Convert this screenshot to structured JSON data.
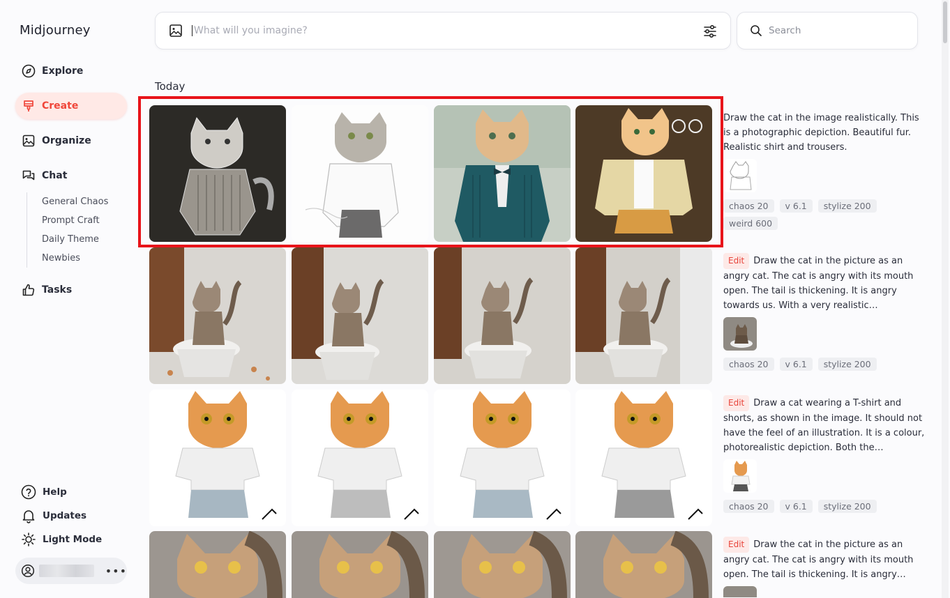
{
  "brand": "Midjourney",
  "nav": {
    "explore": "Explore",
    "create": "Create",
    "organize": "Organize",
    "chat": "Chat",
    "tasks": "Tasks"
  },
  "chat_channels": [
    "General Chaos",
    "Prompt Craft",
    "Daily Theme",
    "Newbies"
  ],
  "footer": {
    "help": "Help",
    "updates": "Updates",
    "light_mode": "Light Mode"
  },
  "prompt": {
    "placeholder": "What will you imagine?"
  },
  "search": {
    "placeholder": "Search"
  },
  "section_title": "Today",
  "jobs": [
    {
      "edit": "",
      "text": "Draw the cat in the image realistically. This is a photographic depiction. Beautiful fur. Realistic shirt and trousers.",
      "chips": [
        "chaos 20",
        "v 6.1",
        "stylize 200",
        "weird 600"
      ]
    },
    {
      "edit": "Edit",
      "text": "Draw the cat in the picture as an angry cat. The cat is angry with its mouth open. The tail is thickening. It is angry towards us. With a very realistic…",
      "chips": [
        "chaos 20",
        "v 6.1",
        "stylize 200"
      ]
    },
    {
      "edit": "Edit",
      "text": "Draw a cat wearing a T-shirt and shorts, as shown in the image. It should not have the feel of an illustration. It is a colour, photorealistic depiction. Both the…",
      "chips": [
        "chaos 20",
        "v 6.1",
        "stylize 200"
      ]
    },
    {
      "edit": "Edit",
      "text": "Draw the cat in the picture as an angry cat. The cat is angry with its mouth open. The tail is thickening. It is angry…",
      "chips": []
    }
  ],
  "colors": {
    "accent": "#f0463a",
    "highlight": "#e8141a"
  }
}
